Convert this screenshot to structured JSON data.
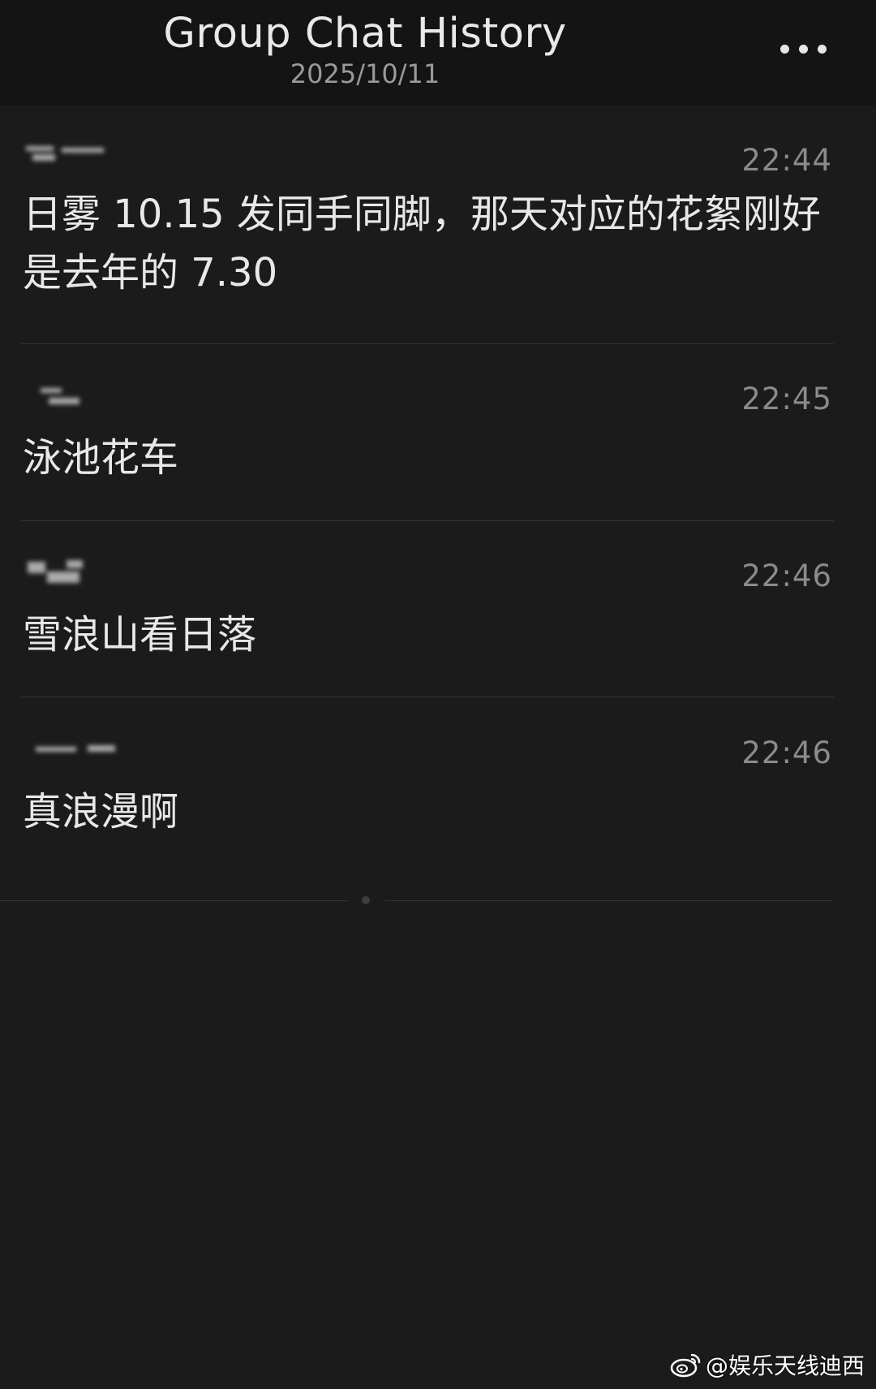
{
  "header": {
    "title": "Group Chat History",
    "date": "2025/10/11",
    "more_icon": "more-horizontal-icon"
  },
  "messages": [
    {
      "sender": "",
      "time": "22:44",
      "text": "日雾 10.15 发同手同脚，那天对应的花絮刚好是去年的 7.30"
    },
    {
      "sender": "",
      "time": "22:45",
      "text": "泳池花车"
    },
    {
      "sender": "",
      "time": "22:46",
      "text": "雪浪山看日落"
    },
    {
      "sender": "",
      "time": "22:46",
      "text": "真浪漫啊"
    }
  ],
  "watermark": {
    "icon": "weibo-logo-icon",
    "text": "@娱乐天线迪西"
  },
  "colors": {
    "background": "#1b1b1b",
    "header_background": "#141414",
    "text": "#e8e8e8",
    "time": "#8b8b8b",
    "divider": "#333333"
  }
}
